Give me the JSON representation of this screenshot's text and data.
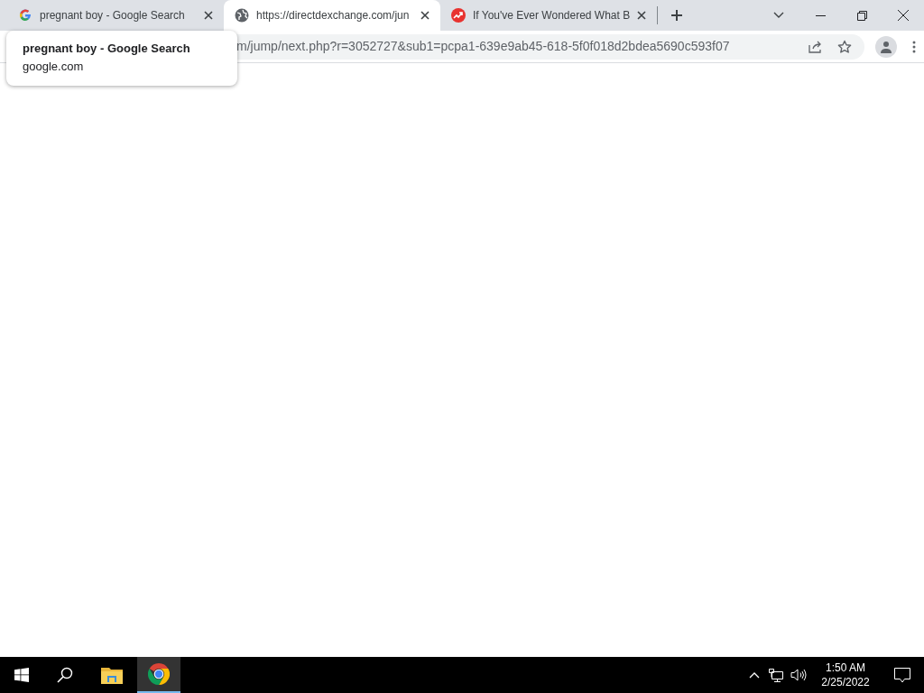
{
  "tabs": [
    {
      "title": "pregnant boy - Google Search",
      "kind": "google",
      "selected": false
    },
    {
      "title": "https://directdexchange.com/jun",
      "kind": "globe",
      "selected": true
    },
    {
      "title": "If You've Ever Wondered What B",
      "kind": "trend",
      "selected": false
    }
  ],
  "address_bar": {
    "value": "m/jump/next.php?r=3052727&sub1=pcpa1-639e9ab45-618-5f0f018d2bdea5690c593f07"
  },
  "tab_tooltip": {
    "title": "pregnant boy - Google Search",
    "domain": "google.com"
  },
  "taskbar": {
    "apps": [
      {
        "kind": "explorer",
        "selected": false
      },
      {
        "kind": "chrome",
        "selected": true
      }
    ],
    "time": "1:50 AM",
    "date": "2/25/2022"
  }
}
